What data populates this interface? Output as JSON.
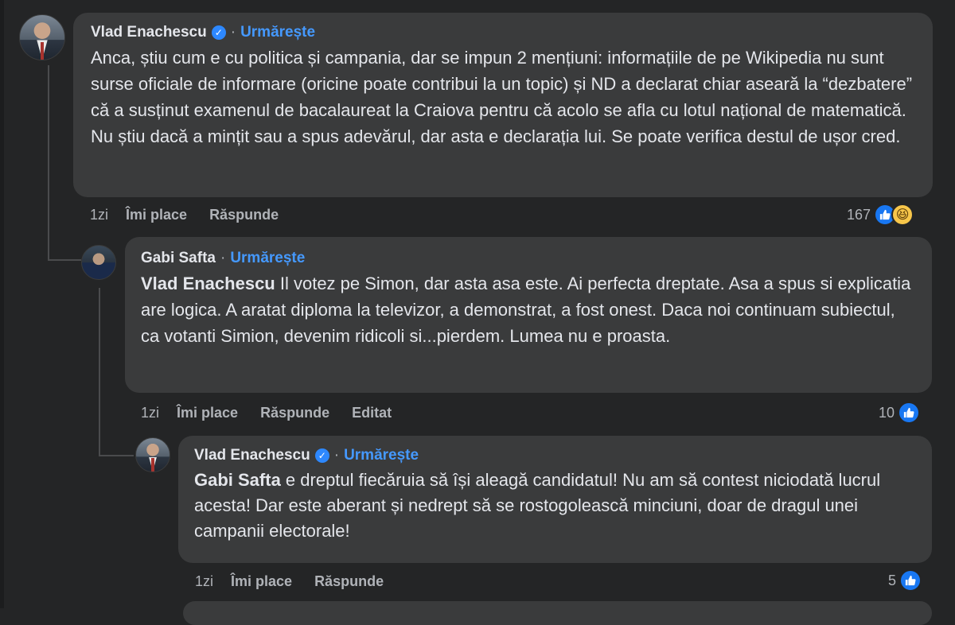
{
  "comment1": {
    "author": "Vlad Enachescu",
    "follow": "Urmărește",
    "text": "Anca, știu cum e cu politica și campania, dar se impun 2 mențiuni: informațiile de pe Wikipedia nu sunt surse oficiale de informare (oricine poate contribui la un topic) și ND a declarat chiar aseară la “dezbatere” că a susținut examenul de bacalaureat la Craiova pentru că acolo se afla cu lotul național de matematică. Nu știu dacă a mințit sau a spus adevărul, dar asta e declarația lui. Se poate verifica destul de ușor cred.",
    "time": "1zi",
    "like": "Îmi place",
    "reply": "Răspunde",
    "reactions": "167"
  },
  "comment2": {
    "author": "Gabi Safta",
    "follow": "Urmărește",
    "mention": "Vlad Enachescu",
    "text": " Il votez pe Simon, dar asta asa este. Ai perfecta dreptate. Asa a spus si explicatia are logica. A aratat diploma la televizor, a demonstrat, a fost onest. Daca noi continuam subiectul, ca votanti Simion, devenim ridicoli si...pierdem. Lumea nu e proasta.",
    "time": "1zi",
    "like": "Îmi place",
    "reply": "Răspunde",
    "edited": "Editat",
    "reactions": "10"
  },
  "comment3": {
    "author": "Vlad Enachescu",
    "follow": "Urmărește",
    "mention": "Gabi Safta",
    "text": " e dreptul fiecăruia să își aleagă candidatul! Nu am să contest niciodată lucrul acesta! Dar este aberant și nedrept să se rostogolească minciuni, doar de dragul unei campanii electorale!",
    "time": "1zi",
    "like": "Îmi place",
    "reply": "Răspunde",
    "reactions": "5"
  },
  "icons": {
    "verified": "verified-badge-icon",
    "like": "like-thumb-icon",
    "haha": "haha-emoji-icon"
  },
  "colors": {
    "background": "#242526",
    "bubble": "#3a3b3c",
    "link": "#4599ff",
    "like": "#1877f2"
  }
}
